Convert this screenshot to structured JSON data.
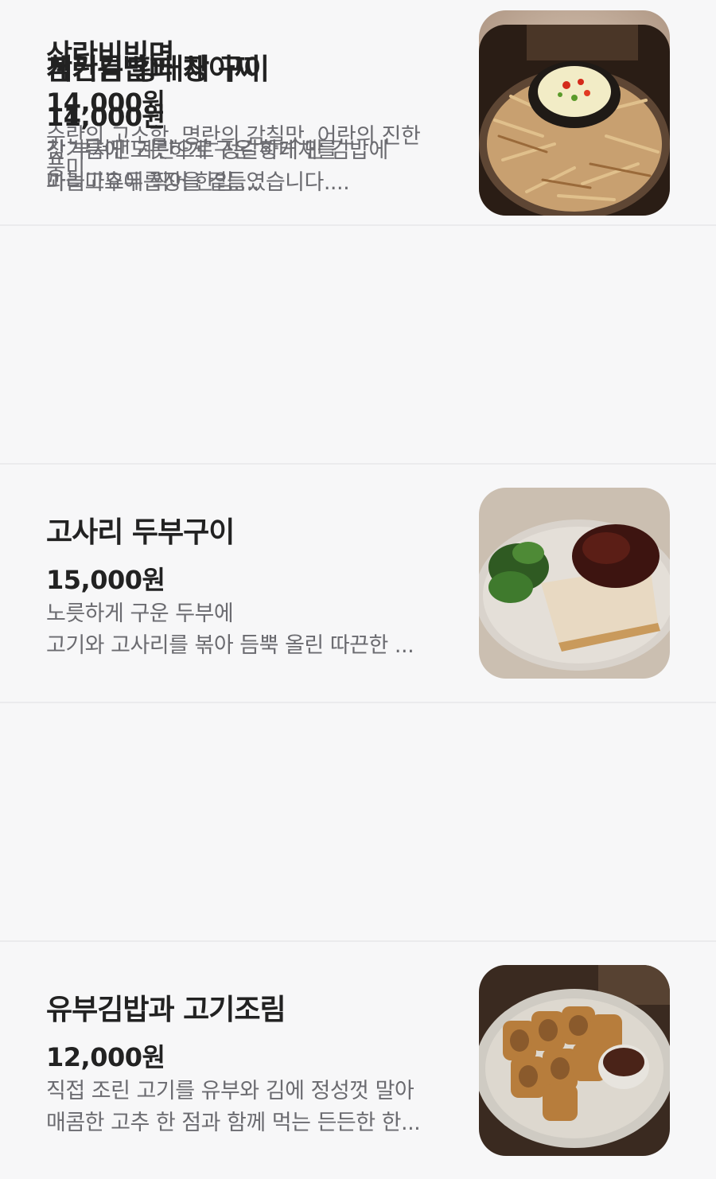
{
  "menu": {
    "items": [
      {
        "name": "삼란비빔면",
        "price": "14,000원",
        "desc_lines": [
          "수란의 고소함, 명란의 감칠맛, 어란의 진한",
          "풍미...."
        ],
        "photo_icon": "bibim-noodle-bowl-photo"
      },
      {
        "name": "고사리 두부구이",
        "price": "15,000원",
        "desc_lines": [
          "노릇하게 구운 두부에",
          "고기와 고사리를 볶아 듬뿍 올린 따끈한 ..."
        ],
        "photo_icon": "grilled-tofu-photo"
      },
      {
        "name": "유부김밥과 고기조림",
        "price": "12,000원",
        "desc_lines": [
          "직접 조린 고기를 유부와 김에 정성껏 말아",
          "매콤한 고추 한 점과 함께 먹는 든든한 한..."
        ],
        "photo_icon": "yubu-gimbap-photo"
      },
      {
        "name": "계란김밥과 장아찌",
        "price": "11,000원",
        "desc_lines": [
          "갓 부쳐낸 계란으로 정갈하게 만 김밥에",
          "꽈리고추두릅장을 곁들였습니다...."
        ],
        "photo_icon": "egg-gimbap-photo"
      },
      {
        "name": "참기름 황태채 구이",
        "price": "14,000원",
        "desc_lines": [
          "참기름에 노릇하게 구운 황태채를",
          "마늘마요에 찍어 한입...."
        ],
        "photo_icon": "dried-pollack-photo"
      }
    ]
  },
  "colors": {
    "background": "#f7f7f8",
    "title": "#222222",
    "description": "#6b6b70",
    "divider": "#ebebed"
  }
}
